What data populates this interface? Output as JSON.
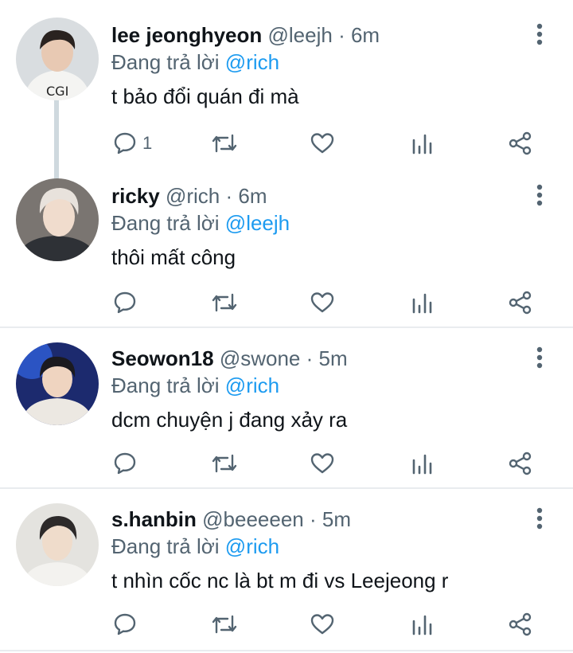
{
  "colors": {
    "text": "#0f1419",
    "muted": "#536471",
    "accent": "#1d9bf0",
    "divider": "#e9ecef",
    "thread": "#cfd9de"
  },
  "replies": [
    {
      "name": "lee jeonghyeon",
      "handle": "@leejh",
      "separator": "·",
      "time": "6m",
      "reply_prefix": "Đang trả lời",
      "reply_to": "@rich",
      "text": "t bảo đổi quán đi mà",
      "reply_count": "1",
      "avatar_icon": "avatar-photo-icon"
    },
    {
      "name": "ricky",
      "handle": "@rich",
      "separator": "·",
      "time": "6m",
      "reply_prefix": "Đang trả lời",
      "reply_to": "@leejh",
      "text": "thôi mất công",
      "reply_count": "",
      "avatar_icon": "avatar-photo-icon"
    },
    {
      "name": "Seowon18",
      "handle": "@swone",
      "separator": "·",
      "time": "5m",
      "reply_prefix": "Đang trả lời",
      "reply_to": "@rich",
      "text": "dcm chuyện j đang xảy ra",
      "reply_count": "",
      "avatar_icon": "avatar-photo-icon"
    },
    {
      "name": "s.hanbin",
      "handle": "@beeeeen",
      "separator": "·",
      "time": "5m",
      "reply_prefix": "Đang trả lời",
      "reply_to": "@rich",
      "text": "t nhìn cốc nc là bt m đi vs Leejeong r",
      "reply_count": "",
      "avatar_icon": "avatar-photo-icon"
    }
  ],
  "action_icons": [
    "reply-icon",
    "retweet-icon",
    "like-icon",
    "analytics-icon",
    "share-icon"
  ]
}
